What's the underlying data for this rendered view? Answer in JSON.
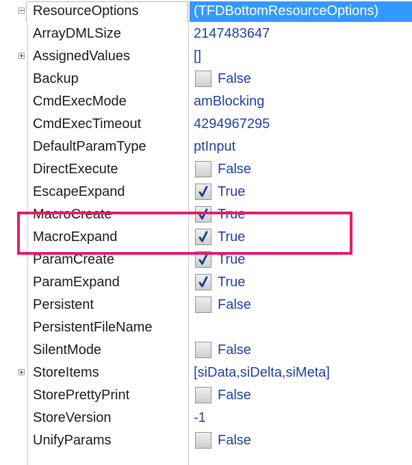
{
  "accent_highlight": "#e8196d",
  "value_color": "#1f3f9f",
  "header": {
    "name": "ResourceOptions",
    "value": "(TFDBottomResourceOptions)"
  },
  "rows": [
    {
      "name": "ArrayDMLSize",
      "value": "2147483647"
    },
    {
      "name": "AssignedValues",
      "value": "[]",
      "expander": true
    },
    {
      "name": "Backup",
      "checked": false,
      "label": "False"
    },
    {
      "name": "CmdExecMode",
      "value": "amBlocking"
    },
    {
      "name": "CmdExecTimeout",
      "value": "4294967295"
    },
    {
      "name": "DefaultParamType",
      "value": "ptInput"
    },
    {
      "name": "DirectExecute",
      "checked": false,
      "label": "False"
    },
    {
      "name": "EscapeExpand",
      "checked": true,
      "label": "True"
    },
    {
      "name": "MacroCreate",
      "checked": true,
      "label": "True"
    },
    {
      "name": "MacroExpand",
      "checked": true,
      "label": "True"
    },
    {
      "name": "ParamCreate",
      "checked": true,
      "label": "True"
    },
    {
      "name": "ParamExpand",
      "checked": true,
      "label": "True"
    },
    {
      "name": "Persistent",
      "checked": false,
      "label": "False"
    },
    {
      "name": "PersistentFileName",
      "value": ""
    },
    {
      "name": "SilentMode",
      "checked": false,
      "label": "False"
    },
    {
      "name": "StoreItems",
      "value": "[siData,siDelta,siMeta]",
      "expander": true
    },
    {
      "name": "StorePrettyPrint",
      "checked": false,
      "label": "False"
    },
    {
      "name": "StoreVersion",
      "value": "-1"
    },
    {
      "name": "UnifyParams",
      "checked": false,
      "label": "False"
    }
  ]
}
